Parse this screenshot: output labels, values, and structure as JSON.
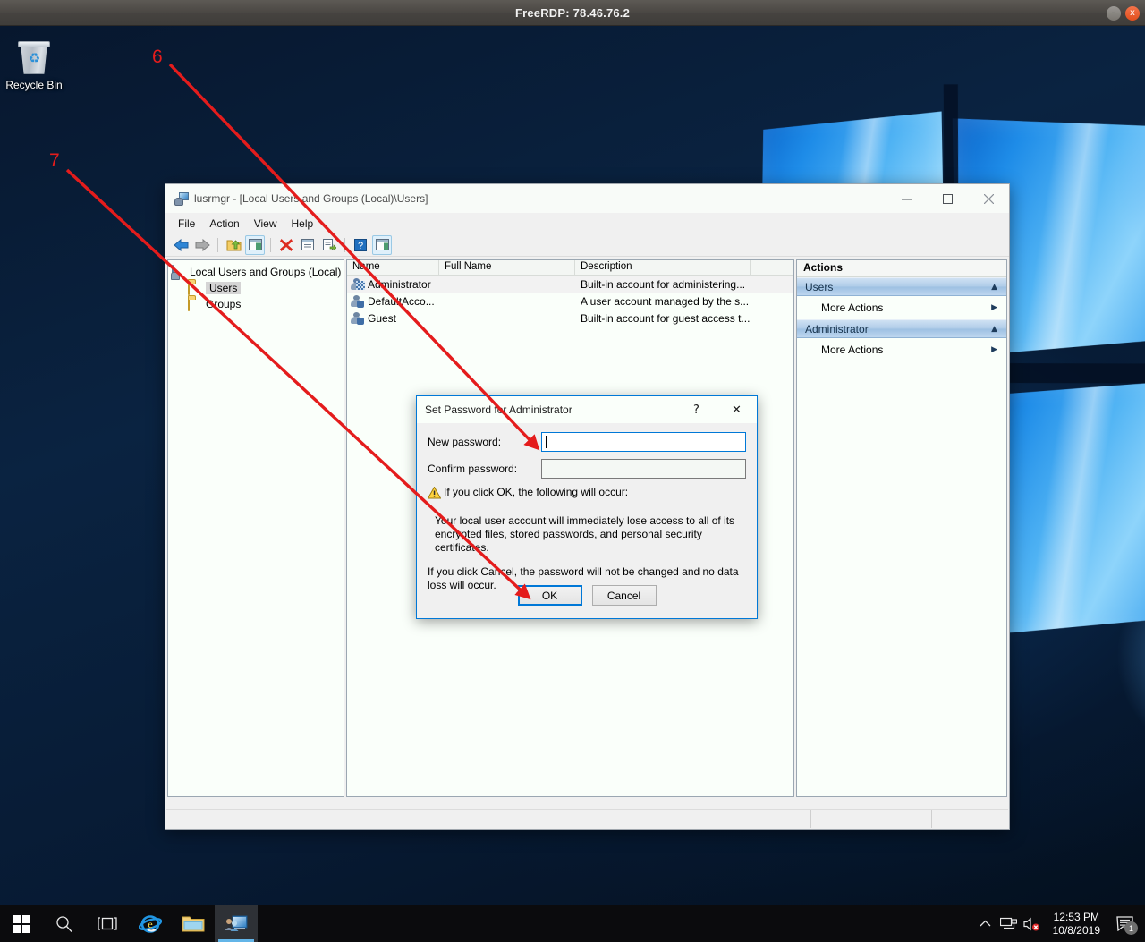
{
  "rdp_window": {
    "title": "FreeRDP: 78.46.76.2",
    "minimize_label": "–",
    "close_label": "x"
  },
  "desktop": {
    "icons": [
      {
        "name": "recycle-bin",
        "label": "Recycle Bin"
      }
    ]
  },
  "mmc_window": {
    "title": "lusrmgr - [Local Users and Groups (Local)\\Users]",
    "title_icon": "computer-users-icon",
    "controls": {
      "minimize": "—",
      "maximize": "□",
      "close": "✕"
    },
    "menu": [
      "File",
      "Action",
      "View",
      "Help"
    ],
    "toolbar_icons": [
      "back-arrow-icon",
      "forward-arrow-icon",
      "separator",
      "up-folder-icon",
      "show-hide-tree-icon",
      "separator",
      "delete-icon",
      "properties-icon",
      "export-list-icon",
      "separator",
      "help-icon",
      "show-action-pane-icon"
    ],
    "tree": {
      "root": "Local Users and Groups (Local)",
      "children": [
        "Users",
        "Groups"
      ],
      "selected": "Users"
    },
    "list": {
      "columns": [
        "Name",
        "Full Name",
        "Description"
      ],
      "rows": [
        {
          "name": "Administrator",
          "full_name": "",
          "description": "Built-in account for administering...",
          "selected": true
        },
        {
          "name": "DefaultAcco...",
          "full_name": "",
          "description": "A user account managed by the s...",
          "selected": false
        },
        {
          "name": "Guest",
          "full_name": "",
          "description": "Built-in account for guest access t...",
          "selected": false
        }
      ]
    },
    "actions_pane": {
      "header": "Actions",
      "groups": [
        {
          "title": "Users",
          "items": [
            "More Actions"
          ]
        },
        {
          "title": "Administrator",
          "items": [
            "More Actions"
          ]
        }
      ]
    },
    "status_bar": ""
  },
  "dialog": {
    "title": "Set Password for Administrator",
    "help_label": "?",
    "close_label": "✕",
    "fields": [
      {
        "label": "New password:",
        "value": "",
        "placeholder": "",
        "focused": true
      },
      {
        "label": "Confirm password:",
        "value": "",
        "placeholder": "",
        "focused": false
      }
    ],
    "warning_icon": "warning-triangle-icon",
    "warning_heading": "If you click OK, the following will occur:",
    "warning_body": "Your local user account will immediately lose access to all of its encrypted files, stored passwords, and personal security certificates.",
    "cancel_note": "If you click Cancel, the password will not be changed and no data loss will occur.",
    "buttons": [
      {
        "label": "OK",
        "default": true
      },
      {
        "label": "Cancel",
        "default": false
      }
    ]
  },
  "annotations": {
    "color": "#e41c1c",
    "markers": [
      {
        "number": "6",
        "target": "new-password-field"
      },
      {
        "number": "7",
        "target": "ok-button"
      }
    ]
  },
  "taskbar": {
    "items": [
      {
        "name": "start-button",
        "icon": "windows-logo-icon"
      },
      {
        "name": "search-button",
        "icon": "search-icon"
      },
      {
        "name": "task-view-button",
        "icon": "task-view-icon"
      },
      {
        "name": "internet-explorer-button",
        "icon": "internet-explorer-icon"
      },
      {
        "name": "file-explorer-button",
        "icon": "folder-icon"
      },
      {
        "name": "lusrmgr-taskbar-button",
        "icon": "computer-users-icon"
      }
    ],
    "tray": {
      "show_hidden_icon": "chevron-up-icon",
      "network_icon": "network-icon",
      "volume_icon": "volume-muted-icon",
      "time": "12:53 PM",
      "date": "10/8/2019",
      "notifications_icon": "action-center-icon",
      "notifications_count": "1"
    }
  }
}
